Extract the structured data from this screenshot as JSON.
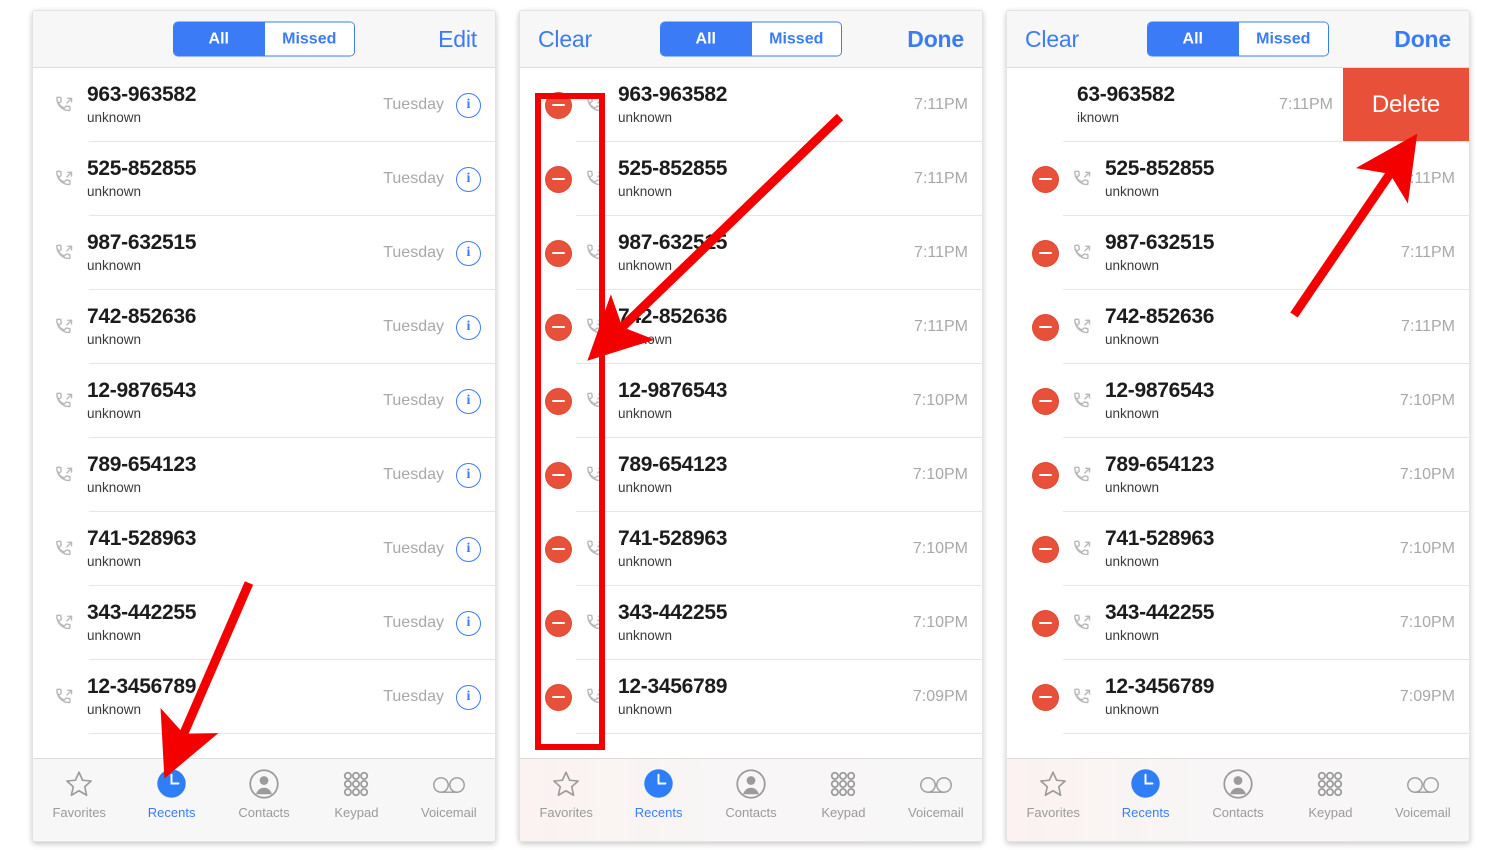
{
  "colors": {
    "accent_blue": "#3b7cf6",
    "delete_red": "#e8503a",
    "annotation_red": "#f40000",
    "nav_background": "#f7f7f7",
    "muted_text": "#a8a8a8"
  },
  "call_entries": [
    {
      "number": "963-963582",
      "label": "unknown",
      "day": "Tuesday",
      "time": "7:11PM"
    },
    {
      "number": "525-852855",
      "label": "unknown",
      "day": "Tuesday",
      "time": "7:11PM"
    },
    {
      "number": "987-632515",
      "label": "unknown",
      "day": "Tuesday",
      "time": "7:11PM"
    },
    {
      "number": "742-852636",
      "label": "unknown",
      "day": "Tuesday",
      "time": "7:11PM"
    },
    {
      "number": "12-9876543",
      "label": "unknown",
      "day": "Tuesday",
      "time": "7:10PM"
    },
    {
      "number": "789-654123",
      "label": "unknown",
      "day": "Tuesday",
      "time": "7:10PM"
    },
    {
      "number": "741-528963",
      "label": "unknown",
      "day": "Tuesday",
      "time": "7:10PM"
    },
    {
      "number": "343-442255",
      "label": "unknown",
      "day": "Tuesday",
      "time": "7:10PM"
    },
    {
      "number": "12-3456789",
      "label": "unknown",
      "day": "Tuesday",
      "time": "7:09PM"
    }
  ],
  "segmented": {
    "all": "All",
    "missed": "Missed",
    "selected": "All"
  },
  "panel1": {
    "nav": {
      "edit": "Edit"
    }
  },
  "panel2": {
    "nav": {
      "clear": "Clear",
      "done": "Done"
    }
  },
  "panel3": {
    "nav": {
      "clear": "Clear",
      "done": "Done"
    },
    "swiped_row": {
      "number": "63-963582",
      "label": "iknown",
      "time": "7:11PM",
      "delete_label": "Delete"
    }
  },
  "tabbar": {
    "items": [
      {
        "label": "Favorites",
        "icon": "star-icon",
        "active": false
      },
      {
        "label": "Recents",
        "icon": "clock-icon",
        "active": true
      },
      {
        "label": "Contacts",
        "icon": "contact-icon",
        "active": false
      },
      {
        "label": "Keypad",
        "icon": "keypad-icon",
        "active": false
      },
      {
        "label": "Voicemail",
        "icon": "voicemail-icon",
        "active": false
      }
    ]
  }
}
